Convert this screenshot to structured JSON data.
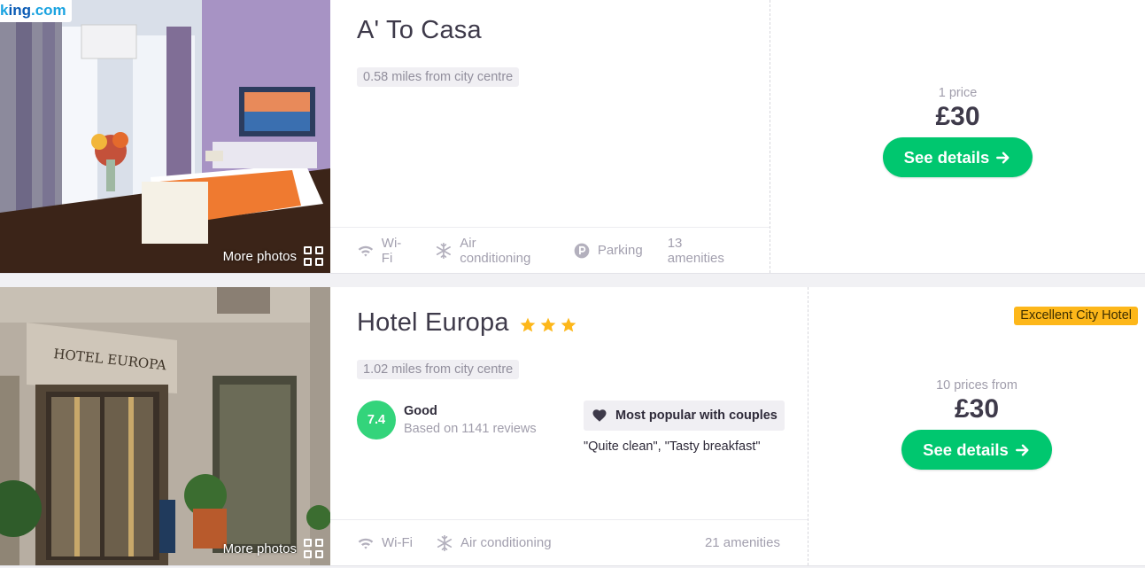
{
  "listings": [
    {
      "provider": {
        "part1": "k",
        "part2": "ing",
        "part3": ".com"
      },
      "more_photos": "More photos",
      "name": "A' To Casa",
      "stars": 0,
      "distance": "0.58 miles from city centre",
      "amenities": [
        "Wi-Fi",
        "Air conditioning",
        "Parking"
      ],
      "amenities_count": "13 amenities",
      "price_label": "1 price",
      "price": "£30",
      "cta": "See details"
    },
    {
      "more_photos": "More photos",
      "name": "Hotel Europa",
      "stars": 3,
      "distance": "1.02 miles from city centre",
      "rating": {
        "score": "7.4",
        "label": "Good",
        "reviews": "Based on 1141 reviews"
      },
      "popular": {
        "label": "Most popular with couples",
        "quotes": "\"Quite clean\", \"Tasty breakfast\""
      },
      "amenities": [
        "Wi-Fi",
        "Air conditioning"
      ],
      "amenities_count": "21 amenities",
      "badge": "Excellent City Hotel",
      "price_label": "10 prices from",
      "price": "£30",
      "cta": "See details",
      "photo_sign": "HOTEL EUROPA"
    }
  ],
  "colors": {
    "cta_green": "#00c76f",
    "score_green": "#33d47b",
    "star_yellow": "#fdb71a",
    "badge_yellow": "#fdb71a",
    "text_dark": "#3e3a4a",
    "text_muted": "#a09dab"
  },
  "icons": [
    "wifi-icon",
    "snowflake-icon",
    "parking-icon",
    "heart-icon",
    "arrow-right-icon",
    "star-icon",
    "grid-icon"
  ]
}
